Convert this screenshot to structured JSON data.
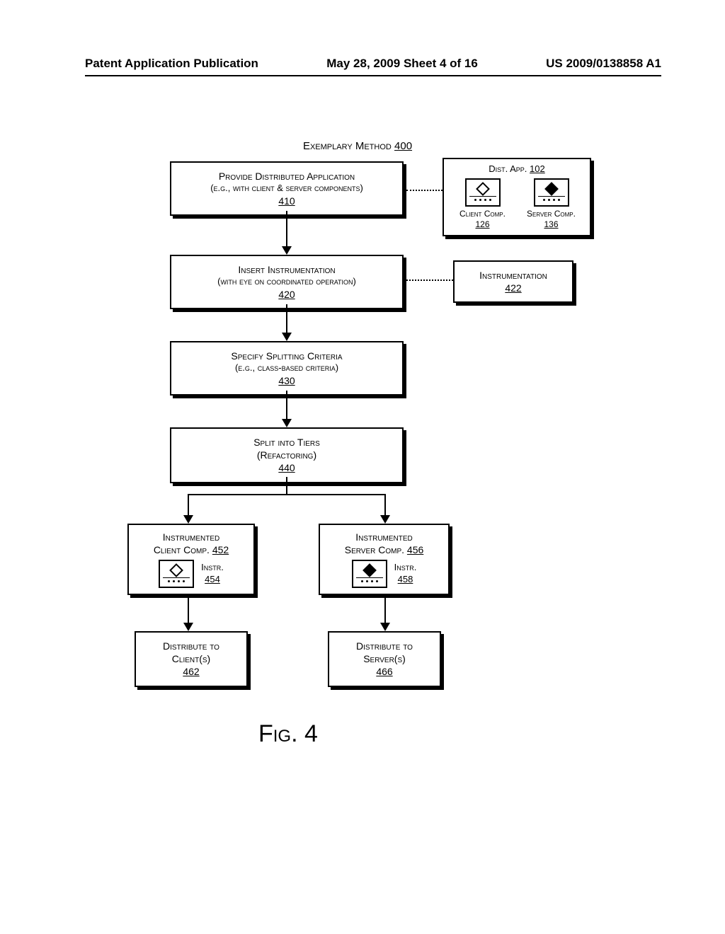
{
  "header": {
    "left": "Patent Application Publication",
    "center": "May 28, 2009  Sheet 4 of 16",
    "right": "US 2009/0138858 A1"
  },
  "diagram_title_prefix": "Exemplary Method",
  "diagram_title_num": "400",
  "box410": {
    "l1": "Provide Distributed Application",
    "l2": "(e.g., with client & server components)",
    "num": "410"
  },
  "dist_app": {
    "title_prefix": "Dist. App.",
    "title_num": "102",
    "client_label": "Client Comp.",
    "client_num": "126",
    "server_label": "Server Comp.",
    "server_num": "136"
  },
  "box420": {
    "l1": "Insert Instrumentation",
    "l2": "(with eye on coordinated operation)",
    "num": "420"
  },
  "instrumentation": {
    "label": "Instrumentation",
    "num": "422"
  },
  "box430": {
    "l1": "Specify Splitting Criteria",
    "l2": "(e.g., class-based criteria)",
    "num": "430"
  },
  "box440": {
    "l1": "Split into Tiers",
    "l2": "(Refactoring)",
    "num": "440"
  },
  "box452": {
    "l1": "Instrumented",
    "l2_prefix": "Client Comp.",
    "l2_num": "452",
    "instr_label": "Instr.",
    "instr_num": "454"
  },
  "box456": {
    "l1": "Instrumented",
    "l2_prefix": "Server Comp.",
    "l2_num": "456",
    "instr_label": "Instr.",
    "instr_num": "458"
  },
  "box462": {
    "l1": "Distribute to",
    "l2": "Client(s)",
    "num": "462"
  },
  "box466": {
    "l1": "Distribute to",
    "l2": "Server(s)",
    "num": "466"
  },
  "figure_label": "Fig. 4"
}
